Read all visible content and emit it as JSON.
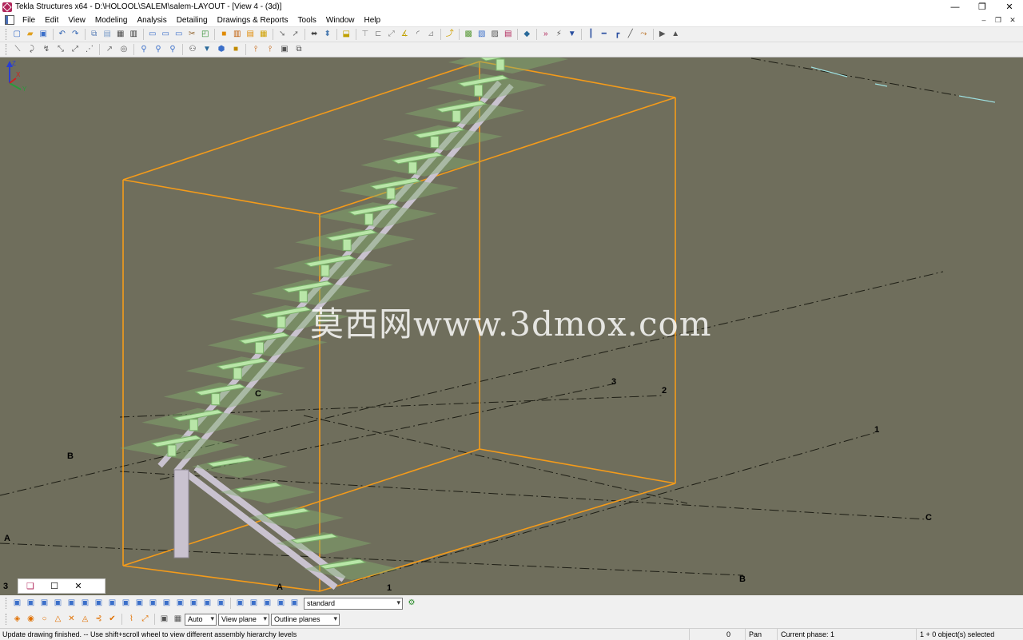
{
  "window": {
    "title": "Tekla Structures x64 - D:\\HOLOOL\\SALEM\\salem-LAYOUT - [View 4 - (3d)]",
    "controls": [
      "—",
      "❐",
      "✕"
    ]
  },
  "menu": {
    "items": [
      "File",
      "Edit",
      "View",
      "Modeling",
      "Analysis",
      "Detailing",
      "Drawings & Reports",
      "Tools",
      "Window",
      "Help"
    ],
    "mdi_controls": [
      "–",
      "❐",
      "✕"
    ]
  },
  "toolbar1": {
    "icons": [
      "new-icon",
      "open-icon",
      "save-icon",
      "|",
      "undo-icon",
      "redo-icon",
      "|",
      "copy-icon",
      "paste-icon",
      "print-icon",
      "properties-icon",
      "|",
      "view-icon",
      "window-icon",
      "snap-icon",
      "cut-icon",
      "zoom-icon",
      "|",
      "model-icon",
      "drawing-icon",
      "report-icon",
      "numbering-icon",
      "|",
      "move-icon",
      "rotate-icon",
      "|",
      "connect-icon",
      "detail-icon",
      "|",
      "weld-icon",
      "|",
      "grid-icon",
      "point-icon",
      "line-icon",
      "angle-icon",
      "arc-icon",
      "measure-icon",
      "|",
      "pick-icon",
      "|",
      "catalog-icon",
      "assembly-icon",
      "component-icon",
      "list-icon",
      "|",
      "tekla-icon",
      "|",
      "run-icon",
      "reinforce-icon",
      "reload-icon",
      "|",
      "beam-icon",
      "plate-icon",
      "column-icon",
      "brace-icon",
      "bolt-icon",
      "|",
      "clip-icon",
      "mark-icon"
    ],
    "colors": [
      "#3b6fc9",
      "#e0a020",
      "#3b6fc9",
      "#555",
      "#2a5fb0",
      "#2a5fb0",
      "#555",
      "#5a7fb8",
      "#7a9cc9",
      "#4a4a4a",
      "#333",
      "#555",
      "#3b6fc9",
      "#3b6fc9",
      "#3b6fc9",
      "#8a5a20",
      "#2a8a2a",
      "#555",
      "#e08a00",
      "#c05a00",
      "#e08a00",
      "#d0a000",
      "#555",
      "#777",
      "#777",
      "#555",
      "#444",
      "#4a7ab0",
      "#555",
      "#c0a000",
      "#555",
      "#888",
      "#888",
      "#888",
      "#c0a000",
      "#555",
      "#999",
      "#555",
      "#d0a000",
      "#c05a00",
      "#5a9a3a",
      "#3b6fc9",
      "#555",
      "#b0245a",
      "#555",
      "#2a6a9a",
      "#b0a000",
      "#b0245a",
      "#555",
      "#2a4fa0",
      "#2a4fa0",
      "#2a4fa0",
      "#2a4fa0",
      "#2a4fa0",
      "#555",
      "#b05a00",
      "#c05a00"
    ]
  },
  "toolbar2": {
    "icons": [
      "line-tool-icon",
      "polyline-tool-icon",
      "curve-tool-icon",
      "snap-endpoint-icon",
      "snap-mid-icon",
      "snap-point-icon",
      "|",
      "snap-perp-icon",
      "circle-icon",
      "|",
      "zoom-in-icon",
      "zoom-out-icon",
      "zoom-prev-icon",
      "|",
      "binoculars-icon",
      "filter-icon",
      "representation-icon",
      "render-icon",
      "|",
      "pin-icon",
      "pin2-icon",
      "select-icon",
      "copy-select-icon"
    ],
    "colors": [
      "#555",
      "#555",
      "#555",
      "#555",
      "#555",
      "#555",
      "#555",
      "#777",
      "#555",
      "#555",
      "#3b6fc9",
      "#3b6fc9",
      "#3b6fc9",
      "#555",
      "#333",
      "#2a6a9a",
      "#3b6fc9",
      "#c08a00",
      "#555",
      "#c05a00",
      "#c05a00",
      "#555",
      "#555"
    ]
  },
  "viewport": {
    "watermark": "莫西网www.3dmox.com",
    "grid_labels": [
      "3",
      "2",
      "1",
      "C",
      "B",
      "A",
      "B",
      "A",
      "3",
      "1",
      "C"
    ],
    "gizmo_axes": [
      "Z",
      "X",
      "Y"
    ]
  },
  "mini_window": {
    "buttons": [
      "❏",
      "☐",
      "✕"
    ]
  },
  "bottom_toolbar1": {
    "icons": [
      "select-all-icon",
      "select-part-icon",
      "select-comp-icon",
      "select-weld-icon",
      "select-bolt-icon",
      "select-grid-icon",
      "select-ref-icon",
      "select-point-icon",
      "select-plane-icon",
      "select-view-icon",
      "select-cut-icon",
      "select-fit-icon",
      "select-assembly-icon",
      "select-object-icon",
      "select-cast-icon",
      "select-anchor-icon",
      "|",
      "select-single-icon",
      "select-multi-icon",
      "select-group-icon",
      "select-filter-icon",
      "select-options-icon"
    ],
    "colors": [
      "#3b6fc9",
      "#3b6fc9",
      "#3b6fc9",
      "#3b6fc9",
      "#3b6fc9",
      "#3b6fc9",
      "#3b6fc9",
      "#3b6fc9",
      "#3b6fc9",
      "#3b6fc9",
      "#3b6fc9",
      "#3b6fc9",
      "#3b6fc9",
      "#3b6fc9",
      "#3b6fc9",
      "#3b6fc9",
      "#555",
      "#3b6fc9",
      "#3b6fc9",
      "#3b6fc9",
      "#3b6fc9",
      "#3b6fc9"
    ],
    "filter_value": "standard"
  },
  "bottom_toolbar2": {
    "icons": [
      "snap-ref-icon",
      "snap-geom-icon",
      "snap-nearest-icon",
      "snap-intersect-icon",
      "snap-free-icon",
      "snap-center-icon",
      "snap-extension-icon",
      "snap-ok-icon",
      "|",
      "snap-orth-icon",
      "snap-line-icon",
      "|",
      "snap-plane-icon",
      "snap-work-icon"
    ],
    "colors": [
      "#e07000",
      "#e07000",
      "#e07000",
      "#e07000",
      "#e07000",
      "#e07000",
      "#e07000",
      "#e07000",
      "#555",
      "#e07000",
      "#e07000",
      "#555",
      "#555",
      "#555"
    ],
    "depth_value": "Auto",
    "plane_value": "View plane",
    "outline_value": "Outline planes"
  },
  "status": {
    "message": "Update drawing finished. -- Use shift+scroll wheel to view different assembly hierarchy levels",
    "count": "0",
    "mode": "Pan",
    "phase": "Current phase: 1",
    "selection": "1 + 0 object(s) selected"
  }
}
